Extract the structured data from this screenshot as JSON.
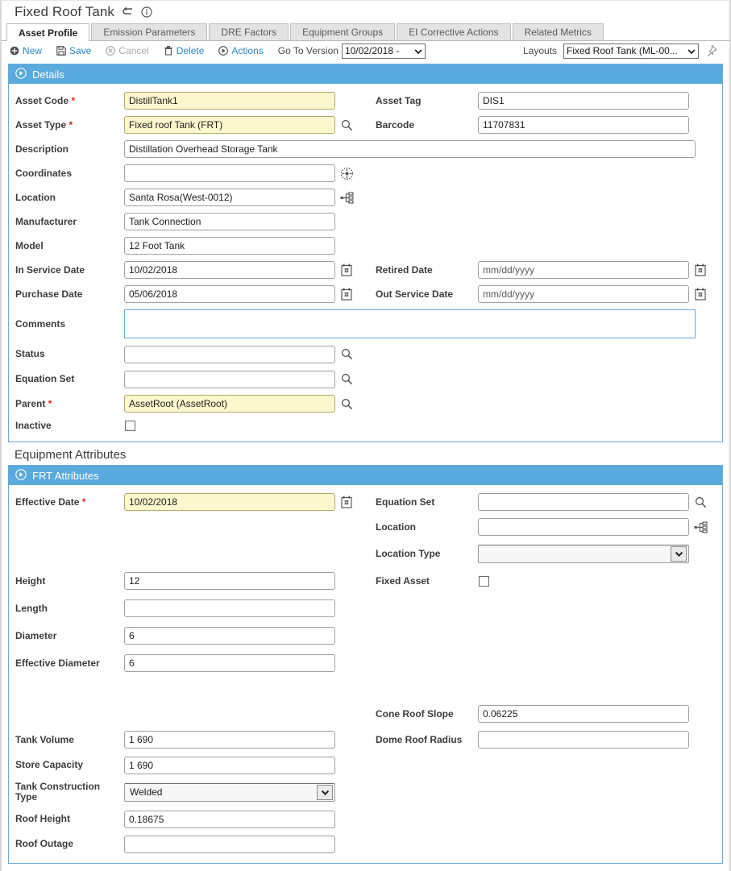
{
  "window": {
    "title": "Fixed Roof Tank",
    "back_icon": "back-arrow-icon",
    "info_icon": "info-circle-icon"
  },
  "tabs": [
    {
      "label": "Asset Profile",
      "active": true
    },
    {
      "label": "Emission Parameters",
      "active": false
    },
    {
      "label": "DRE Factors",
      "active": false
    },
    {
      "label": "Equipment Groups",
      "active": false
    },
    {
      "label": "EI Corrective Actions",
      "active": false
    },
    {
      "label": "Related Metrics",
      "active": false
    }
  ],
  "toolbar": {
    "new_label": "New",
    "save_label": "Save",
    "cancel_label": "Cancel",
    "delete_label": "Delete",
    "actions_label": "Actions",
    "go_to_version_label": "Go To Version",
    "version_value": "10/02/2018 -",
    "layouts_label": "Layouts",
    "layout_value": "Fixed Roof Tank (ML-00...",
    "pin_icon": "pin-icon"
  },
  "details": {
    "header": "Details",
    "fields": {
      "asset_code": {
        "label": "Asset Code",
        "required": true,
        "value": "DistillTank1"
      },
      "asset_tag": {
        "label": "Asset Tag",
        "required": false,
        "value": "DIS1"
      },
      "asset_type": {
        "label": "Asset Type",
        "required": true,
        "value": "Fixed roof Tank (FRT)"
      },
      "barcode": {
        "label": "Barcode",
        "required": false,
        "value": "11707831"
      },
      "description": {
        "label": "Description",
        "required": false,
        "value": "Distillation Overhead Storage Tank"
      },
      "coordinates": {
        "label": "Coordinates",
        "required": false,
        "value": ""
      },
      "location": {
        "label": "Location",
        "required": false,
        "value": "Santa Rosa(West-0012)"
      },
      "manufacturer": {
        "label": "Manufacturer",
        "required": false,
        "value": "Tank Connection"
      },
      "model": {
        "label": "Model",
        "required": false,
        "value": "12 Foot Tank"
      },
      "in_service_date": {
        "label": "In Service Date",
        "required": false,
        "value": "10/02/2018"
      },
      "retired_date": {
        "label": "Retired Date",
        "required": false,
        "value": "",
        "placeholder": "mm/dd/yyyy"
      },
      "purchase_date": {
        "label": "Purchase Date",
        "required": false,
        "value": "05/06/2018"
      },
      "out_service_date": {
        "label": "Out Service Date",
        "required": false,
        "value": "",
        "placeholder": "mm/dd/yyyy"
      },
      "comments": {
        "label": "Comments",
        "required": false,
        "value": ""
      },
      "status": {
        "label": "Status",
        "required": false,
        "value": ""
      },
      "equation_set": {
        "label": "Equation Set",
        "required": false,
        "value": ""
      },
      "parent": {
        "label": "Parent",
        "required": true,
        "value": "AssetRoot (AssetRoot)"
      },
      "inactive": {
        "label": "Inactive",
        "required": false,
        "checked": false
      }
    }
  },
  "equipment_attributes": {
    "section_title": "Equipment Attributes",
    "header": "FRT Attributes",
    "fields": {
      "effective_date": {
        "label": "Effective Date",
        "required": true,
        "value": "10/02/2018"
      },
      "equation_set": {
        "label": "Equation Set",
        "required": false,
        "value": ""
      },
      "location": {
        "label": "Location",
        "required": false,
        "value": ""
      },
      "location_type": {
        "label": "Location Type",
        "required": false,
        "value": ""
      },
      "fixed_asset": {
        "label": "Fixed Asset",
        "required": false,
        "checked": false
      },
      "height": {
        "label": "Height",
        "required": false,
        "value": "12"
      },
      "length": {
        "label": "Length",
        "required": false,
        "value": ""
      },
      "diameter": {
        "label": "Diameter",
        "required": false,
        "value": "6"
      },
      "effective_diameter": {
        "label": "Effective Diameter",
        "required": false,
        "value": "6"
      },
      "cone_roof_slope": {
        "label": "Cone Roof Slope",
        "required": false,
        "value": "0.06225"
      },
      "dome_roof_radius": {
        "label": "Dome Roof Radius",
        "required": false,
        "value": ""
      },
      "tank_volume": {
        "label": "Tank Volume",
        "required": false,
        "value": "1 690"
      },
      "store_capacity": {
        "label": "Store Capacity",
        "required": false,
        "value": "1 690"
      },
      "tank_construction_type": {
        "label": "Tank Construction Type",
        "required": false,
        "value": "Welded"
      },
      "roof_height": {
        "label": "Roof Height",
        "required": false,
        "value": "0.18675"
      },
      "roof_outage": {
        "label": "Roof Outage",
        "required": false,
        "value": ""
      }
    }
  },
  "colors": {
    "accent_blue": "#59aadd",
    "link_blue": "#2c88c8",
    "required_yellow": "#fcf7cd",
    "required_red": "#e02020"
  }
}
